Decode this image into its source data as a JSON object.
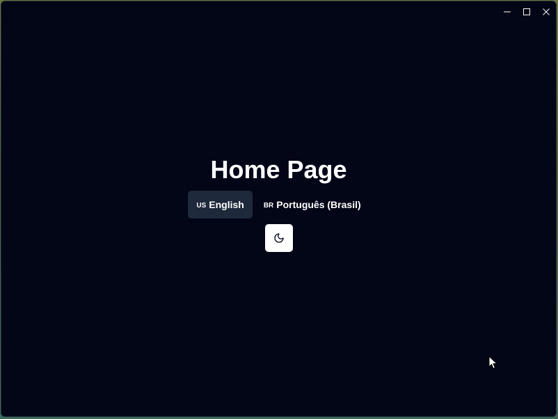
{
  "window": {
    "controls": {
      "minimize": "minimize-icon",
      "maximize": "maximize-icon",
      "close": "close-icon"
    }
  },
  "main": {
    "title": "Home Page",
    "languages": [
      {
        "code": "US",
        "label": "English",
        "selected": true
      },
      {
        "code": "BR",
        "label": "Português (Brasil)",
        "selected": false
      }
    ],
    "theme_toggle": {
      "icon": "moon-icon"
    }
  },
  "colors": {
    "background": "#020617",
    "selected_language_bg": "#1e293b",
    "text": "#ffffff",
    "theme_button_bg": "#ffffff",
    "theme_icon": "#020617"
  }
}
